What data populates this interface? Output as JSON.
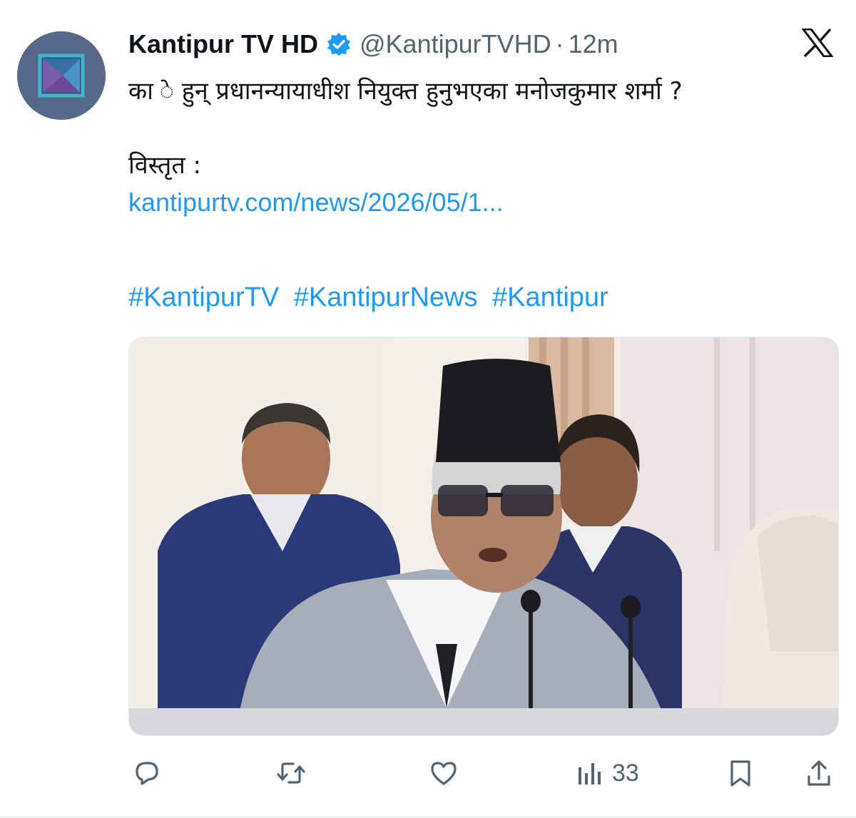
{
  "tweet": {
    "display_name": "Kantipur TV HD",
    "handle": "@KantipurTVHD",
    "separator": "·",
    "time": "12m",
    "text_line1": "का े हुन् प्रधानन्यायाधीश नियुक्त हुनुभएका मनोजकुमार शर्मा ?",
    "text_line2": "विस्तृत :",
    "link": "kantipurtv.com/news/2026/05/1...",
    "hashtags": [
      "#KantipurTV",
      "#KantipurNews",
      "#Kantipur"
    ]
  },
  "actions": {
    "views_count": "33"
  },
  "icons": {
    "verified": "verified-badge-icon",
    "platform": "x-logo-icon",
    "reply": "reply-icon",
    "retweet": "retweet-icon",
    "like": "heart-icon",
    "views": "views-chart-icon",
    "bookmark": "bookmark-icon",
    "share": "share-icon"
  },
  "colors": {
    "accent": "#1d9bf0",
    "secondary_text": "#536471",
    "primary_text": "#0f1419",
    "avatar_bg": "#5a6c88"
  }
}
